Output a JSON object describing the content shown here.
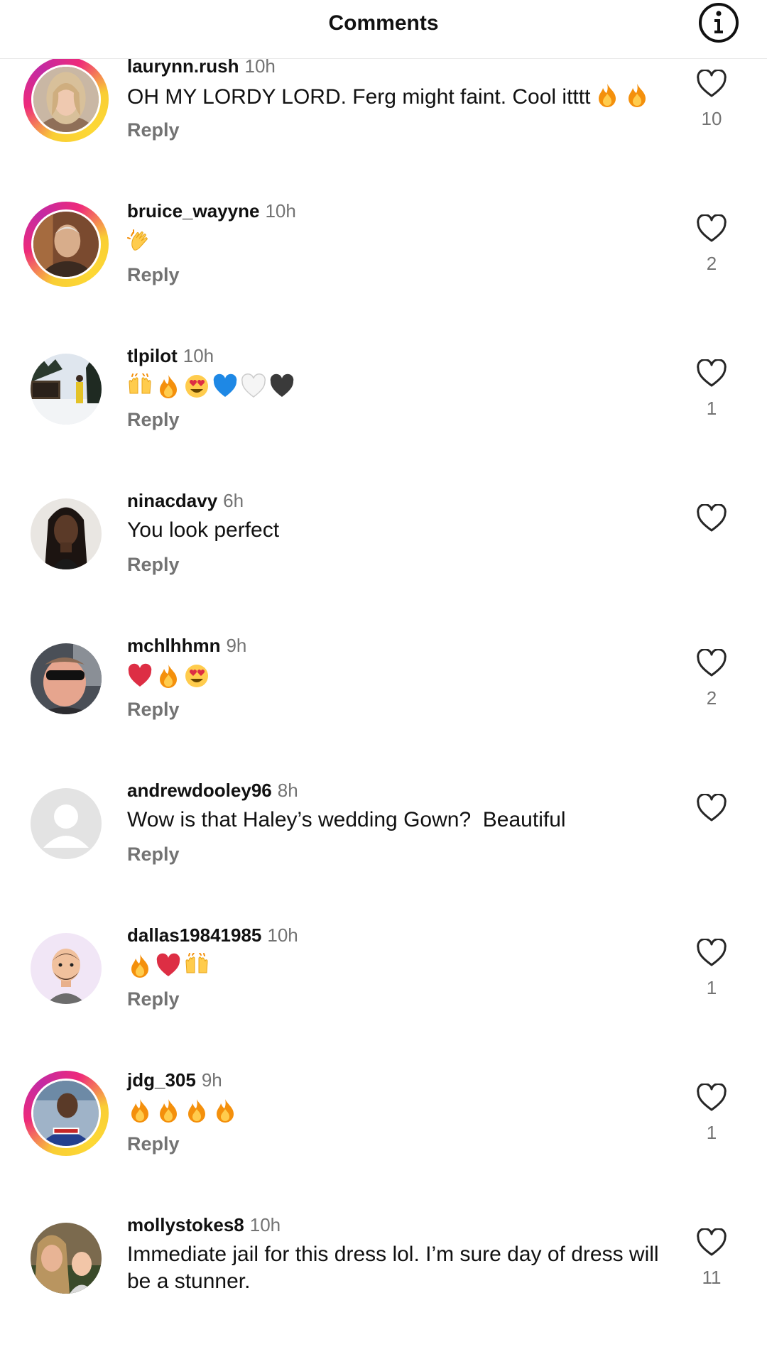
{
  "header": {
    "title": "Comments",
    "info_icon": "info-icon"
  },
  "comments": [
    {
      "username": "laurynn.rush",
      "time": "10h",
      "text": "OH MY LORDY LORD. Ferg might faint. Cool itttt",
      "emojis": [
        "fire",
        "fire"
      ],
      "reply": "Reply",
      "likes": "10",
      "story_ring": true
    },
    {
      "username": "bruice_wayyne",
      "time": "10h",
      "text": "",
      "emojis": [
        "clapping-hands"
      ],
      "reply": "Reply",
      "likes": "2",
      "story_ring": true
    },
    {
      "username": "tlpilot",
      "time": "10h",
      "text": "",
      "emojis": [
        "raising-hands",
        "fire",
        "heart-eyes",
        "blue-heart",
        "white-heart",
        "black-heart"
      ],
      "reply": "Reply",
      "likes": "1",
      "story_ring": false
    },
    {
      "username": "ninacdavy",
      "time": "6h",
      "text": "You look perfect",
      "emojis": [],
      "reply": "Reply",
      "likes": "",
      "story_ring": false
    },
    {
      "username": "mchlhhmn",
      "time": "9h",
      "text": "",
      "emojis": [
        "red-heart",
        "fire",
        "heart-eyes"
      ],
      "reply": "Reply",
      "likes": "2",
      "story_ring": false
    },
    {
      "username": "andrewdooley96",
      "time": "8h",
      "text": "Wow is that Haley’s wedding Gown?  Beautiful",
      "emojis": [],
      "reply": "Reply",
      "likes": "",
      "story_ring": false
    },
    {
      "username": "dallas19841985",
      "time": "10h",
      "text": "",
      "emojis": [
        "fire",
        "red-heart",
        "raising-hands"
      ],
      "reply": "Reply",
      "likes": "1",
      "story_ring": false
    },
    {
      "username": "jdg_305",
      "time": "9h",
      "text": "",
      "emojis": [
        "fire",
        "fire",
        "fire",
        "fire"
      ],
      "reply": "Reply",
      "likes": "1",
      "story_ring": true
    },
    {
      "username": "mollystokes8",
      "time": "10h",
      "text": "Immediate jail for this dress lol. I’m sure day of dress will be a stunner.",
      "emojis": [],
      "reply": "",
      "likes": "11",
      "story_ring": false
    }
  ],
  "colors": {
    "text": "#111111",
    "secondary": "#737373",
    "story_ring_start": "#f9ce34",
    "story_ring_end": "#ee2a7b"
  }
}
